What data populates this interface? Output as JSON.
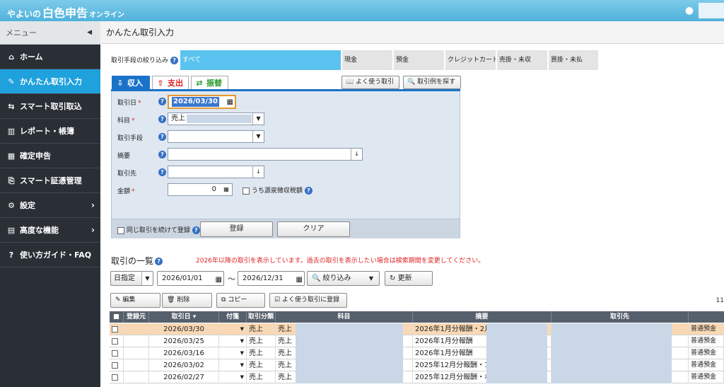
{
  "header": {
    "brand_prefix": "やよいの",
    "brand_main": "白色申告",
    "brand_suffix": "オンライン"
  },
  "sidebar": {
    "menu_label": "メニュー",
    "collapse_glyph": "◀",
    "items": [
      {
        "label": "ホーム",
        "icon": "⌂"
      },
      {
        "label": "かんたん取引入力",
        "icon": "✎"
      },
      {
        "label": "スマート取引取込",
        "icon": "⇆"
      },
      {
        "label": "レポート・帳簿",
        "icon": "▥"
      },
      {
        "label": "確定申告",
        "icon": "▦"
      },
      {
        "label": "スマート証憑管理",
        "icon": "⎘"
      },
      {
        "label": "設定",
        "icon": "⚙"
      },
      {
        "label": "高度な機能",
        "icon": "▤"
      },
      {
        "label": "使い方ガイド・FAQ",
        "icon": "?"
      }
    ]
  },
  "page_title": "かんたん取引入力",
  "filter": {
    "label": "取引手段の絞り込み",
    "tabs": [
      "すべて",
      "現金",
      "預金",
      "クレジットカード",
      "売掛・未収",
      "買掛・未払"
    ]
  },
  "entry": {
    "tabs": {
      "income": "収入",
      "expense": "支出",
      "transfer": "振替"
    },
    "frequent_button": "よく使う取引",
    "examples_button": "取引例を探す",
    "fields": {
      "date_label": "取引日",
      "date_value": "2026/03/30",
      "account_label": "科目",
      "account_value": "売上",
      "method_label": "取引手段",
      "summary_label": "摘要",
      "partner_label": "取引先",
      "amount_label": "金額",
      "amount_value": "0",
      "withholding_label": "うち源泉徴収税額",
      "required_mark": "*"
    },
    "continue_label": "同じ取引を続けて登録",
    "register_button": "登録",
    "clear_button": "クリア"
  },
  "list": {
    "title": "取引の一覧",
    "notice": "2026年以降の取引を表示しています。過去の取引を表示したい場合は検索期間を変更してください。",
    "period_type": "日指定",
    "date_from": "2026/01/01",
    "range_sep": "～",
    "date_to": "2026/12/31",
    "filter_button": "絞り込み",
    "refresh_button": "更新",
    "edit_button": "編集",
    "delete_button": "削除",
    "copy_button": "コピー",
    "save_frequent_button": "よく使う取引に登録",
    "count_text": "11",
    "columns": [
      "登録元",
      "取引日 ▾",
      "付箋",
      "取引分類",
      "科目",
      "摘要",
      "取引先"
    ],
    "rows": [
      {
        "date": "2026/03/30",
        "category": "売上",
        "account": "売上（",
        "summary": "2026年1月分報酬・2月:",
        "method": "普通預金"
      },
      {
        "date": "2026/03/25",
        "category": "売上",
        "account": "売上（",
        "summary": "2026年1月分報酬",
        "method": "普通預金"
      },
      {
        "date": "2026/03/16",
        "category": "売上",
        "account": "売上（",
        "summary": "2026年1月分報酬",
        "method": "普通預金"
      },
      {
        "date": "2026/03/02",
        "category": "売上",
        "account": "売上（",
        "summary": "2025年12月分報酬・1月",
        "method": "普通預金"
      },
      {
        "date": "2026/02/27",
        "category": "売上",
        "account": "売上（",
        "summary": "2025年12月分報酬・ボ・",
        "method": "普通預金"
      }
    ]
  }
}
